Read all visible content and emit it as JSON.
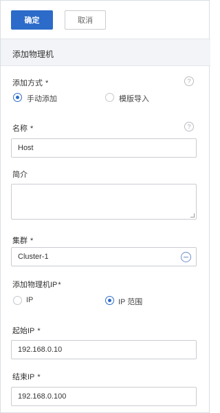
{
  "toolbar": {
    "confirm_label": "确定",
    "cancel_label": "取消"
  },
  "section": {
    "title": "添加物理机"
  },
  "form": {
    "add_method": {
      "label": "添加方式",
      "required_mark": "*",
      "help_glyph": "?",
      "options": [
        {
          "label": "手动添加",
          "selected": true
        },
        {
          "label": "模版导入",
          "selected": false
        }
      ]
    },
    "name": {
      "label": "名称",
      "required_mark": "*",
      "help_glyph": "?",
      "value": "Host"
    },
    "description": {
      "label": "简介",
      "value": ""
    },
    "cluster": {
      "label": "集群",
      "required_mark": "*",
      "value": "Cluster-1"
    },
    "ip_mode": {
      "label": "添加物理机IP",
      "required_mark": "*",
      "options": [
        {
          "label": "IP",
          "selected": false
        },
        {
          "label": "IP 范围",
          "selected": true
        }
      ]
    },
    "start_ip": {
      "label": "起始IP",
      "required_mark": "*",
      "value": "192.168.0.10"
    },
    "end_ip": {
      "label": "结束IP",
      "required_mark": "*",
      "value": "192.168.0.100"
    }
  },
  "colors": {
    "primary": "#2c6bc9",
    "header_bg": "#f2f4f7",
    "border": "#c9ccd1"
  }
}
